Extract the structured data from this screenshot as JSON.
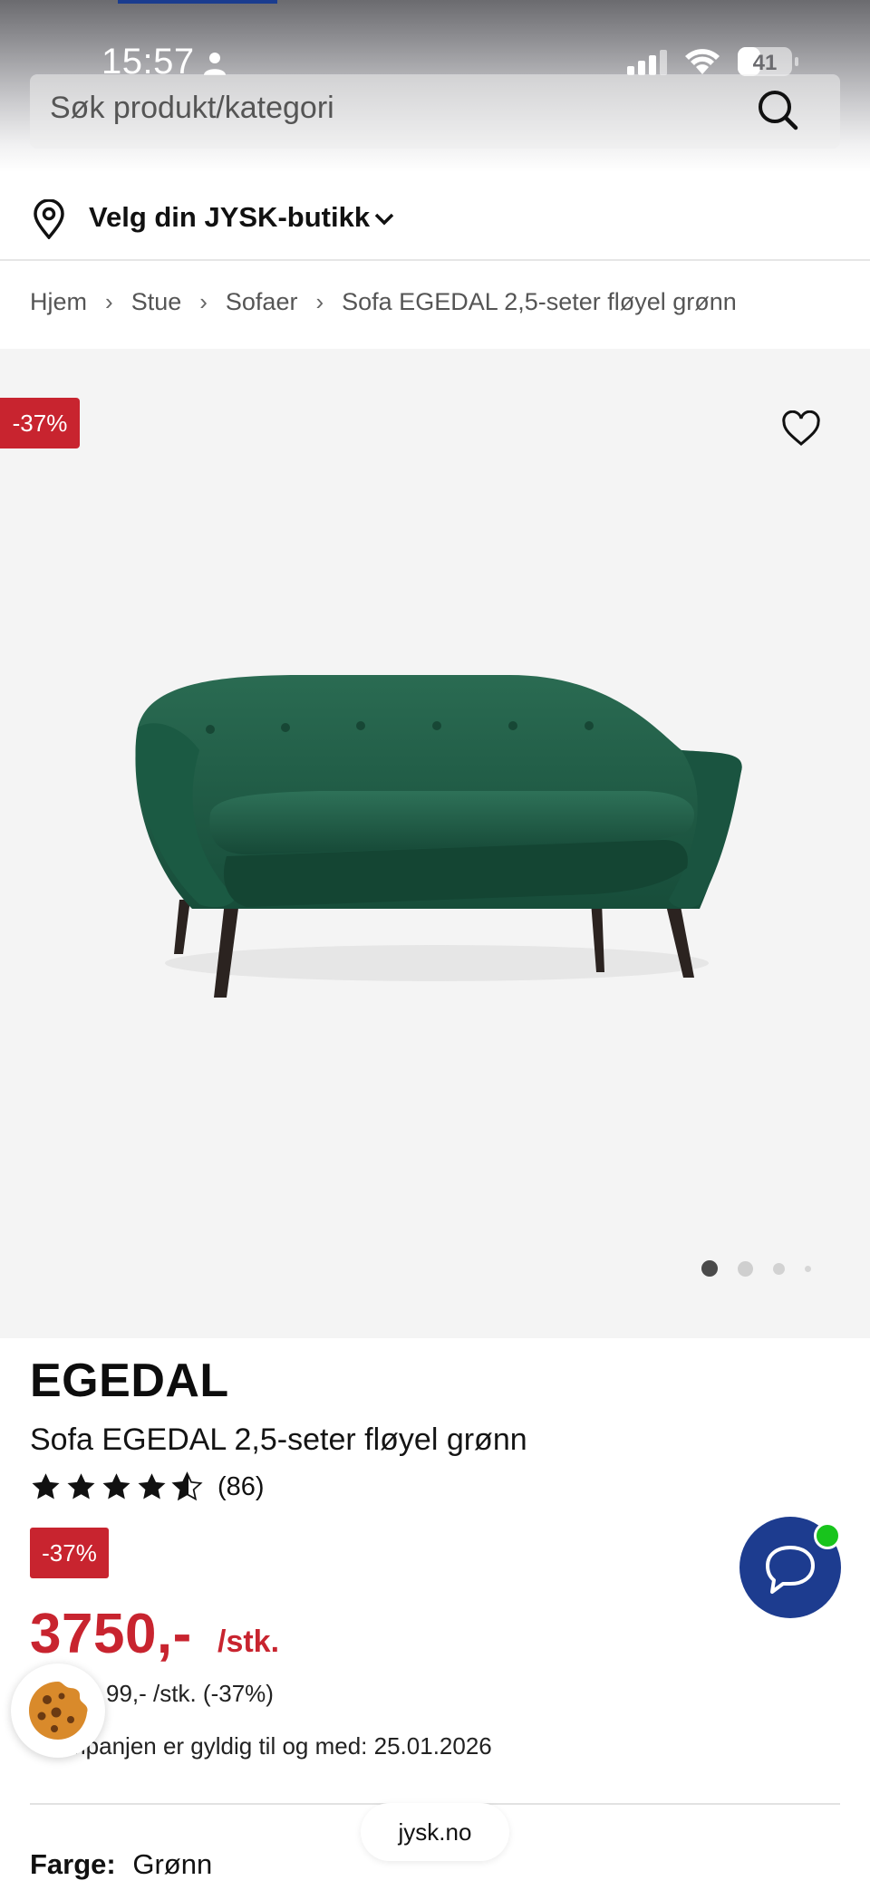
{
  "status_bar": {
    "time": "15:57",
    "battery": "41",
    "battery_level_percent": 41
  },
  "search": {
    "placeholder": "Søk produkt/kategori",
    "icon": "search-icon"
  },
  "store": {
    "label": "Velg din JYSK-butikk",
    "icon": "location-pin-icon"
  },
  "breadcrumb": [
    "Hjem",
    "Stue",
    "Sofaer",
    "Sofa EGEDAL 2,5-seter fløyel grønn"
  ],
  "breadcrumb_separator": "›",
  "gallery": {
    "discount_badge": "-37%",
    "favorite_icon": "heart-icon",
    "image_count": 4,
    "active_index": 0
  },
  "product": {
    "brand": "EGEDAL",
    "name": "Sofa EGEDAL 2,5-seter fløyel grønn",
    "rating_value": 4.5,
    "rating_max": 5,
    "review_count": "(86)",
    "discount_badge": "-37%",
    "price": "3750,-",
    "price_unit": "/stk.",
    "old_price": "99,- /stk. (-37%)",
    "campaign": "mpanjen er gyldig til og med: 25.01.2026",
    "color_label": "Farge:",
    "color_value": "Grønn"
  },
  "browser": {
    "url": "jysk.no"
  },
  "colors": {
    "brand_red": "#c8242f",
    "brand_blue": "#1d3c8f",
    "online_green": "#18c41c",
    "sofa_green": "#1f5a45"
  }
}
